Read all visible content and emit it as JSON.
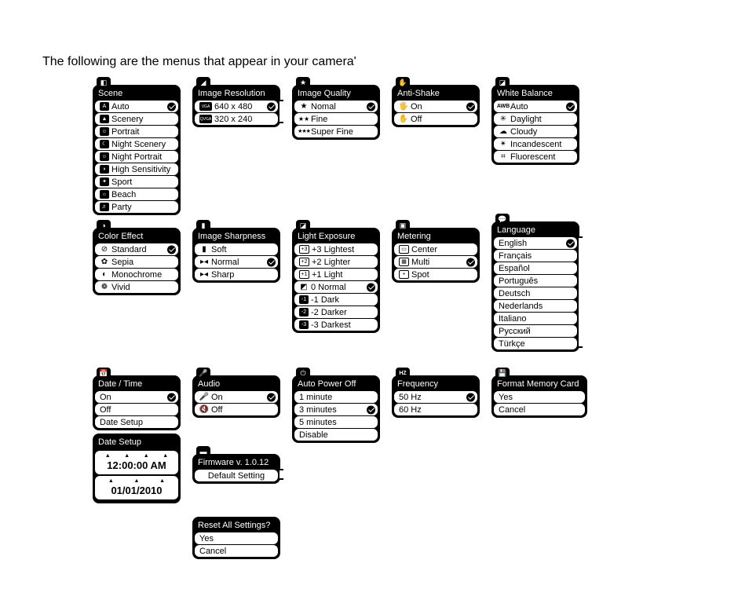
{
  "intro": "The following are the menus that appear in your camera'",
  "panels": {
    "scene": {
      "title": "Scene",
      "items": [
        "Auto",
        "Scenery",
        "Portrait",
        "Night Scenery",
        "Night Portrait",
        "High Sensitivity",
        "Sport",
        "Beach",
        "Party"
      ],
      "selected": 0
    },
    "resolution": {
      "title": "Image Resolution",
      "items": [
        [
          "VGA",
          "640 x 480"
        ],
        [
          "QVGA",
          "320 x 240"
        ]
      ],
      "selected": 0
    },
    "quality": {
      "title": "Image Quality",
      "items": [
        "Nomal",
        "Fine",
        "Super Fine"
      ],
      "selected": 0
    },
    "antishake": {
      "title": "Anti-Shake",
      "items": [
        "On",
        "Off"
      ],
      "selected": 0
    },
    "wb": {
      "title": "White Balance",
      "items": [
        "Auto",
        "Daylight",
        "Cloudy",
        "Incandescent",
        "Fluorescent"
      ],
      "selected": 0
    },
    "effect": {
      "title": "Color Effect",
      "items": [
        "Standard",
        "Sepia",
        "Monochrome",
        "Vivid"
      ],
      "selected": 0
    },
    "sharpness": {
      "title": "Image Sharpness",
      "items": [
        "Soft",
        "Normal",
        "Sharp"
      ],
      "selected": 1
    },
    "exposure": {
      "title": "Light Exposure",
      "items": [
        "+3 Lightest",
        "+2 Lighter",
        "+1 Light",
        "0 Normal",
        "-1 Dark",
        "-2 Darker",
        "-3 Darkest"
      ],
      "selected": 3
    },
    "metering": {
      "title": "Metering",
      "items": [
        "Center",
        "Multi",
        "Spot"
      ],
      "selected": 1
    },
    "language": {
      "title": "Language",
      "items": [
        "English",
        "Français",
        "Español",
        "Português",
        "Deutsch",
        "Nederlands",
        "Italiano",
        "Русский",
        "Türkçe"
      ],
      "selected": 0
    },
    "datetime": {
      "title": "Date / Time",
      "items": [
        "On",
        "Off",
        "Date Setup"
      ],
      "selected": 0
    },
    "datesetup": {
      "title": "Date Setup",
      "time": "12:00:00 AM",
      "date": "01/01/2010"
    },
    "audio": {
      "title": "Audio",
      "items": [
        "On",
        "Off"
      ],
      "selected": 0
    },
    "autopower": {
      "title": "Auto Power Off",
      "items": [
        "1 minute",
        "3 minutes",
        "5 minutes",
        "Disable"
      ],
      "selected": 1
    },
    "frequency": {
      "title": "Frequency",
      "items": [
        "50 Hz",
        "60 Hz"
      ],
      "selected": 0
    },
    "format": {
      "title": "Format Memory Card",
      "items": [
        "Yes",
        "Cancel"
      ]
    },
    "firmware": {
      "title": "Firmware v. 1.0.12",
      "items": [
        "Default Setting"
      ]
    },
    "reset": {
      "title": "Reset All Settings?",
      "items": [
        "Yes",
        "Cancel"
      ]
    }
  }
}
